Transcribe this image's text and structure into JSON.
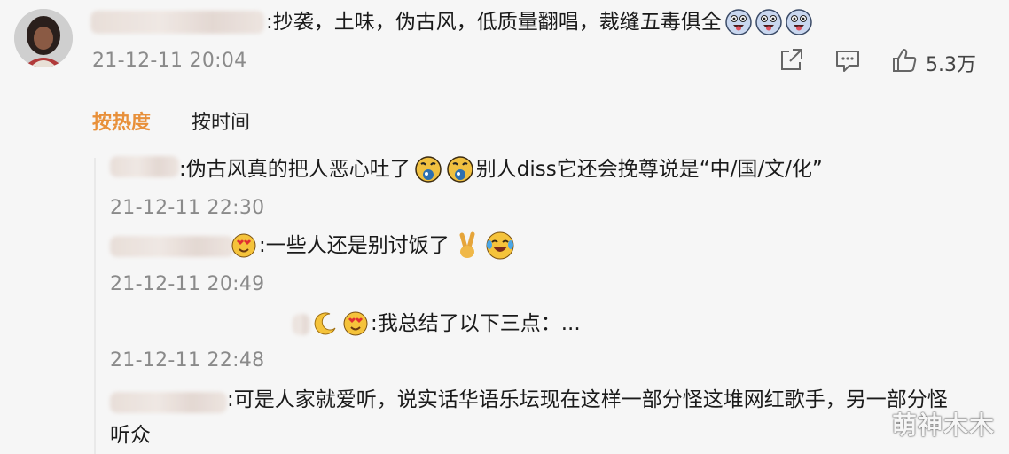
{
  "main_comment": {
    "text": ":抄袭，土味，伪古风，低质量翻唱，裁缝五毒俱全",
    "timestamp": "21-12-11 20:04",
    "emoji_icons": [
      "grinning-tongue-emoji",
      "grinning-tongue-emoji",
      "grinning-tongue-emoji"
    ]
  },
  "actions": {
    "share_icon": "share-icon",
    "comment_icon": "comment-icon",
    "like_icon": "thumbs-up-icon",
    "like_count": "5.3万"
  },
  "sort_tabs": {
    "hot": "按热度",
    "time": "按时间"
  },
  "replies": [
    {
      "text_before": ":伪古风真的把人恶心吐了",
      "text_after": "别人diss它还会挽尊说是“中/国/文/化”",
      "timestamp": "21-12-11 22:30"
    },
    {
      "text": ":一些人还是别讨饭了",
      "timestamp": "21-12-11 20:49"
    },
    {
      "text": ":我总结了以下三点：...",
      "timestamp": "21-12-11 22:48"
    },
    {
      "text": ":可是人家就爱听，说实话华语乐坛现在这样一部分怪这堆网红歌手，另一部分怪",
      "text_line2": "听众"
    }
  ],
  "watermark": "萌神木木",
  "colors": {
    "active_sort": "#e8903a",
    "timestamp": "#8a8a8a",
    "background": "#f6f6f6"
  }
}
